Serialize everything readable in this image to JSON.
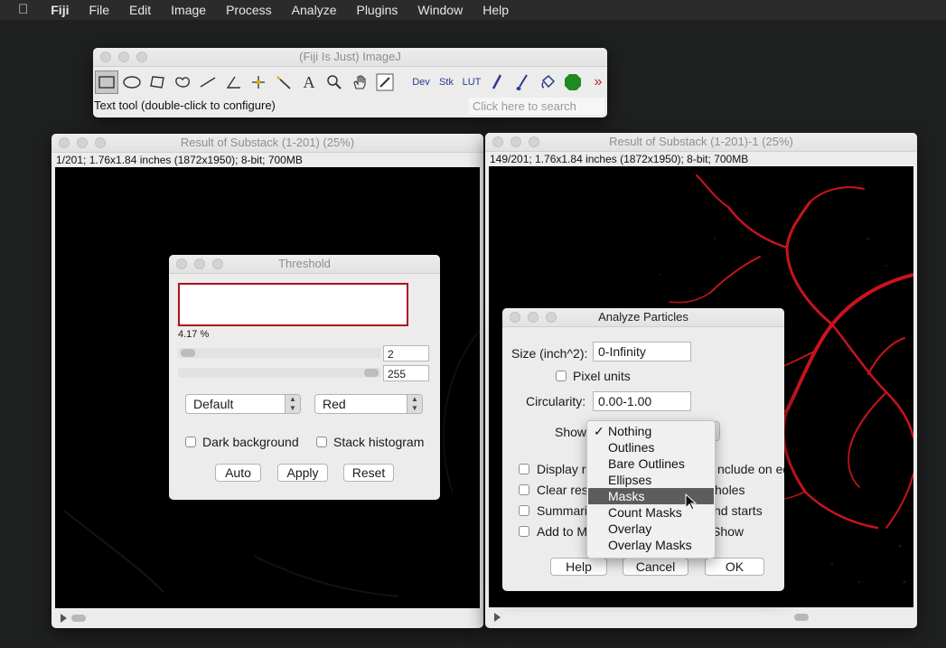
{
  "menubar": {
    "items": [
      "Fiji",
      "File",
      "Edit",
      "Image",
      "Process",
      "Analyze",
      "Plugins",
      "Window",
      "Help"
    ]
  },
  "toolbar": {
    "title": "(Fiji Is Just) ImageJ",
    "status": "Text tool (double-click to configure)",
    "search_placeholder": "Click here to search",
    "dev_label": "Dev",
    "stk_label": "Stk",
    "lut_label": "LUT",
    "tool_icons": [
      "rectangle-select-icon",
      "oval-select-icon",
      "polygon-select-icon",
      "freehand-select-icon",
      "line-tool-icon",
      "angle-tool-icon",
      "point-tool-icon",
      "wand-tool-icon",
      "text-tool-icon",
      "zoom-tool-icon",
      "hand-tool-icon",
      "color-picker-icon",
      "pencil-icon",
      "brush-icon",
      "flood-fill-icon",
      "green-octagon-icon",
      "more-tools-icon"
    ]
  },
  "left_window": {
    "title": "Result of Substack (1-201) (25%)",
    "info": "1/201; 1.76x1.84 inches (1872x1950); 8-bit; 700MB"
  },
  "right_window": {
    "title": "Result of Substack (1-201)-1 (25%)",
    "info": "149/201; 1.76x1.84 inches (1872x1950); 8-bit; 700MB"
  },
  "threshold": {
    "title": "Threshold",
    "percent": "4.17 %",
    "min_value": "2",
    "max_value": "255",
    "method": "Default",
    "mode": "Red",
    "dark_background": "Dark background",
    "stack_histogram": "Stack histogram",
    "auto": "Auto",
    "apply": "Apply",
    "reset": "Reset"
  },
  "analyze_particles": {
    "title": "Analyze Particles",
    "size_label": "Size (inch^2):",
    "size_value": "0-Infinity",
    "pixel_units": "Pixel units",
    "circularity_label": "Circularity:",
    "circularity_value": "0.00-1.00",
    "show_label": "Show:",
    "display_label": "Display r",
    "include_label": "nclude on edges",
    "clear_label": "Clear res",
    "holes_label": "holes",
    "summarize_label": "Summariz",
    "starts_label": "nd starts",
    "add_label": "Add to M",
    "show_overlay_label": "Show",
    "help": "Help",
    "cancel": "Cancel",
    "ok": "OK"
  },
  "show_menu": {
    "selected": "Nothing",
    "highlighted": "Masks",
    "options": [
      "Nothing",
      "Outlines",
      "Bare Outlines",
      "Ellipses",
      "Masks",
      "Count Masks",
      "Overlay",
      "Overlay Masks"
    ]
  }
}
